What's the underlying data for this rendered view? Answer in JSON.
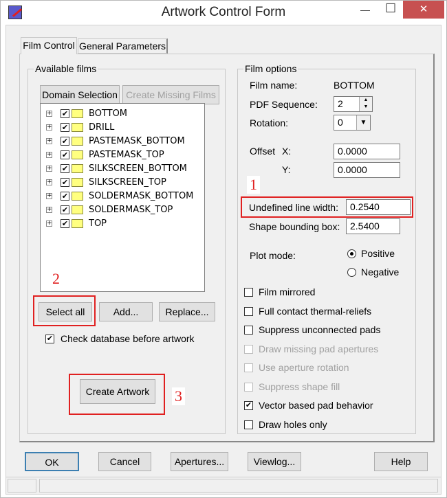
{
  "window": {
    "title": "Artwork Control Form",
    "min": "—",
    "max": "☐",
    "close": "✕"
  },
  "tabs": [
    {
      "label": "Film Control",
      "active": true
    },
    {
      "label": "General Parameters",
      "active": false
    }
  ],
  "available_films": {
    "label": "Available films",
    "domain_selection": "Domain Selection",
    "create_missing": "Create Missing Films",
    "films": [
      "BOTTOM",
      "DRILL",
      "PASTEMASK_BOTTOM",
      "PASTEMASK_TOP",
      "SILKSCREEN_BOTTOM",
      "SILKSCREEN_TOP",
      "SOLDERMASK_BOTTOM",
      "SOLDERMASK_TOP",
      "TOP"
    ],
    "select_all": "Select all",
    "add": "Add...",
    "replace": "Replace...",
    "check_db": "Check database before artwork",
    "check_db_checked": true,
    "create_artwork": "Create Artwork"
  },
  "film_options": {
    "label": "Film options",
    "film_name_label": "Film name:",
    "film_name": "BOTTOM",
    "pdf_seq_label": "PDF Sequence:",
    "pdf_seq": "2",
    "rotation_label": "Rotation:",
    "rotation": "0",
    "offset_label": "Offset",
    "x_label": "X:",
    "x": "0.0000",
    "y_label": "Y:",
    "y": "0.0000",
    "ulw_label": "Undefined line width:",
    "ulw": "0.2540",
    "sbb_label": "Shape bounding box:",
    "sbb": "2.5400",
    "plot_mode_label": "Plot mode:",
    "positive": "Positive",
    "negative": "Negative",
    "plot_mode": "Positive",
    "checks": [
      {
        "label": "Film mirrored",
        "checked": false,
        "enabled": true
      },
      {
        "label": "Full contact thermal-reliefs",
        "checked": false,
        "enabled": true
      },
      {
        "label": "Suppress unconnected pads",
        "checked": false,
        "enabled": true
      },
      {
        "label": "Draw missing pad apertures",
        "checked": false,
        "enabled": false
      },
      {
        "label": "Use aperture rotation",
        "checked": false,
        "enabled": false
      },
      {
        "label": "Suppress shape fill",
        "checked": false,
        "enabled": false
      },
      {
        "label": "Vector based pad behavior",
        "checked": true,
        "enabled": true
      },
      {
        "label": "Draw holes only",
        "checked": false,
        "enabled": true
      }
    ]
  },
  "buttons": {
    "ok": "OK",
    "cancel": "Cancel",
    "apertures": "Apertures...",
    "viewlog": "Viewlog...",
    "help": "Help"
  },
  "annotations": [
    "1",
    "2",
    "3"
  ]
}
